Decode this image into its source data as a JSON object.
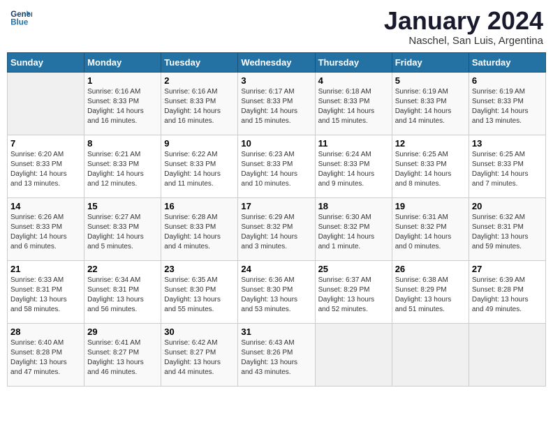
{
  "header": {
    "logo_line1": "General",
    "logo_line2": "Blue",
    "month": "January 2024",
    "location": "Naschel, San Luis, Argentina"
  },
  "weekdays": [
    "Sunday",
    "Monday",
    "Tuesday",
    "Wednesday",
    "Thursday",
    "Friday",
    "Saturday"
  ],
  "weeks": [
    [
      {
        "day": "",
        "info": ""
      },
      {
        "day": "1",
        "info": "Sunrise: 6:16 AM\nSunset: 8:33 PM\nDaylight: 14 hours\nand 16 minutes."
      },
      {
        "day": "2",
        "info": "Sunrise: 6:16 AM\nSunset: 8:33 PM\nDaylight: 14 hours\nand 16 minutes."
      },
      {
        "day": "3",
        "info": "Sunrise: 6:17 AM\nSunset: 8:33 PM\nDaylight: 14 hours\nand 15 minutes."
      },
      {
        "day": "4",
        "info": "Sunrise: 6:18 AM\nSunset: 8:33 PM\nDaylight: 14 hours\nand 15 minutes."
      },
      {
        "day": "5",
        "info": "Sunrise: 6:19 AM\nSunset: 8:33 PM\nDaylight: 14 hours\nand 14 minutes."
      },
      {
        "day": "6",
        "info": "Sunrise: 6:19 AM\nSunset: 8:33 PM\nDaylight: 14 hours\nand 13 minutes."
      }
    ],
    [
      {
        "day": "7",
        "info": "Sunrise: 6:20 AM\nSunset: 8:33 PM\nDaylight: 14 hours\nand 13 minutes."
      },
      {
        "day": "8",
        "info": "Sunrise: 6:21 AM\nSunset: 8:33 PM\nDaylight: 14 hours\nand 12 minutes."
      },
      {
        "day": "9",
        "info": "Sunrise: 6:22 AM\nSunset: 8:33 PM\nDaylight: 14 hours\nand 11 minutes."
      },
      {
        "day": "10",
        "info": "Sunrise: 6:23 AM\nSunset: 8:33 PM\nDaylight: 14 hours\nand 10 minutes."
      },
      {
        "day": "11",
        "info": "Sunrise: 6:24 AM\nSunset: 8:33 PM\nDaylight: 14 hours\nand 9 minutes."
      },
      {
        "day": "12",
        "info": "Sunrise: 6:25 AM\nSunset: 8:33 PM\nDaylight: 14 hours\nand 8 minutes."
      },
      {
        "day": "13",
        "info": "Sunrise: 6:25 AM\nSunset: 8:33 PM\nDaylight: 14 hours\nand 7 minutes."
      }
    ],
    [
      {
        "day": "14",
        "info": "Sunrise: 6:26 AM\nSunset: 8:33 PM\nDaylight: 14 hours\nand 6 minutes."
      },
      {
        "day": "15",
        "info": "Sunrise: 6:27 AM\nSunset: 8:33 PM\nDaylight: 14 hours\nand 5 minutes."
      },
      {
        "day": "16",
        "info": "Sunrise: 6:28 AM\nSunset: 8:33 PM\nDaylight: 14 hours\nand 4 minutes."
      },
      {
        "day": "17",
        "info": "Sunrise: 6:29 AM\nSunset: 8:32 PM\nDaylight: 14 hours\nand 3 minutes."
      },
      {
        "day": "18",
        "info": "Sunrise: 6:30 AM\nSunset: 8:32 PM\nDaylight: 14 hours\nand 1 minute."
      },
      {
        "day": "19",
        "info": "Sunrise: 6:31 AM\nSunset: 8:32 PM\nDaylight: 14 hours\nand 0 minutes."
      },
      {
        "day": "20",
        "info": "Sunrise: 6:32 AM\nSunset: 8:31 PM\nDaylight: 13 hours\nand 59 minutes."
      }
    ],
    [
      {
        "day": "21",
        "info": "Sunrise: 6:33 AM\nSunset: 8:31 PM\nDaylight: 13 hours\nand 58 minutes."
      },
      {
        "day": "22",
        "info": "Sunrise: 6:34 AM\nSunset: 8:31 PM\nDaylight: 13 hours\nand 56 minutes."
      },
      {
        "day": "23",
        "info": "Sunrise: 6:35 AM\nSunset: 8:30 PM\nDaylight: 13 hours\nand 55 minutes."
      },
      {
        "day": "24",
        "info": "Sunrise: 6:36 AM\nSunset: 8:30 PM\nDaylight: 13 hours\nand 53 minutes."
      },
      {
        "day": "25",
        "info": "Sunrise: 6:37 AM\nSunset: 8:29 PM\nDaylight: 13 hours\nand 52 minutes."
      },
      {
        "day": "26",
        "info": "Sunrise: 6:38 AM\nSunset: 8:29 PM\nDaylight: 13 hours\nand 51 minutes."
      },
      {
        "day": "27",
        "info": "Sunrise: 6:39 AM\nSunset: 8:28 PM\nDaylight: 13 hours\nand 49 minutes."
      }
    ],
    [
      {
        "day": "28",
        "info": "Sunrise: 6:40 AM\nSunset: 8:28 PM\nDaylight: 13 hours\nand 47 minutes."
      },
      {
        "day": "29",
        "info": "Sunrise: 6:41 AM\nSunset: 8:27 PM\nDaylight: 13 hours\nand 46 minutes."
      },
      {
        "day": "30",
        "info": "Sunrise: 6:42 AM\nSunset: 8:27 PM\nDaylight: 13 hours\nand 44 minutes."
      },
      {
        "day": "31",
        "info": "Sunrise: 6:43 AM\nSunset: 8:26 PM\nDaylight: 13 hours\nand 43 minutes."
      },
      {
        "day": "",
        "info": ""
      },
      {
        "day": "",
        "info": ""
      },
      {
        "day": "",
        "info": ""
      }
    ]
  ]
}
